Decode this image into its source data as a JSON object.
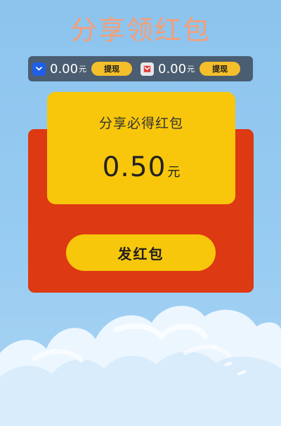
{
  "page": {
    "title": "分享领红包"
  },
  "balance_bar": {
    "items": [
      {
        "icon": "blue-wallet-icon",
        "amount": "0.00",
        "unit": "元",
        "button_label": "提现"
      },
      {
        "icon": "red-pocket-icon",
        "amount": "0.00",
        "unit": "元",
        "button_label": "提现"
      }
    ]
  },
  "reward_card": {
    "title": "分享必得红包",
    "amount": "0.50",
    "unit": "元"
  },
  "actions": {
    "send_label": "发红包"
  },
  "colors": {
    "title": "#f59e78",
    "panel_red": "#dd3912",
    "card_yellow": "#f8c70b",
    "button_yellow": "#f7c70b",
    "bar_dark": "#4a5d71"
  }
}
